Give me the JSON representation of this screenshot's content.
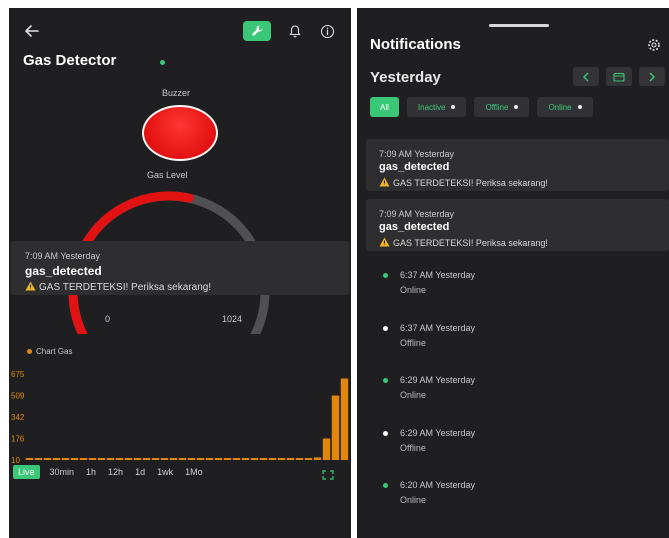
{
  "colors": {
    "accent": "#3ac878",
    "danger": "#e31212",
    "chart_orange": "#e3870c",
    "warning": "#f2b61d",
    "panel_bg": "#1f1f21",
    "card_bg": "#2e2e31"
  },
  "left": {
    "header": {
      "back_icon": "arrow-left-icon",
      "wrench_icon": "wrench-icon",
      "bell_icon": "bell-icon",
      "info_icon": "info-icon"
    },
    "device_title": "Gas Detector",
    "buzzer_label": "Buzzer",
    "gas_level_label": "Gas Level",
    "gauge": {
      "min_label": "0",
      "max_label": "1024",
      "value_fraction": 0.55
    },
    "toast": {
      "time": "7:09 AM Yesterday",
      "title": "gas_detected",
      "message": "GAS TERDETEKSI! Periksa sekarang!"
    },
    "time_ranges": [
      "Live",
      "30min",
      "1h",
      "12h",
      "1d",
      "1wk",
      "1Mo"
    ],
    "expand_icon": "expand-icon"
  },
  "chart_data": {
    "type": "bar",
    "legend": "Chart Gas",
    "yticks": [
      "675",
      "509",
      "342",
      "176",
      "10"
    ],
    "ylim": [
      10,
      675
    ],
    "values": [
      22,
      22,
      22,
      22,
      22,
      22,
      22,
      22,
      22,
      22,
      22,
      22,
      22,
      22,
      22,
      22,
      22,
      22,
      22,
      22,
      22,
      22,
      22,
      22,
      22,
      22,
      22,
      22,
      22,
      22,
      22,
      22,
      30,
      176,
      509,
      640
    ]
  },
  "right": {
    "title": "Notifications",
    "settings_icon": "gear-icon",
    "day": "Yesterday",
    "filters": [
      {
        "label": "All",
        "active": true,
        "dot": false
      },
      {
        "label": "Inactive",
        "active": false,
        "dot": true
      },
      {
        "label": "Offline",
        "active": false,
        "dot": true
      },
      {
        "label": "Online",
        "active": false,
        "dot": true
      }
    ],
    "cards": [
      {
        "time": "7:09 AM Yesterday",
        "title": "gas_detected",
        "message": "GAS TERDETEKSI! Periksa sekarang!"
      },
      {
        "time": "7:09 AM Yesterday",
        "title": "gas_detected",
        "message": "GAS TERDETEKSI! Periksa sekarang!"
      }
    ],
    "events": [
      {
        "time": "6:37 AM Yesterday",
        "status": "Online"
      },
      {
        "time": "6:37 AM Yesterday",
        "status": "Offline"
      },
      {
        "time": "6:29 AM Yesterday",
        "status": "Online"
      },
      {
        "time": "6:29 AM Yesterday",
        "status": "Offline"
      },
      {
        "time": "6:20 AM Yesterday",
        "status": "Online"
      }
    ]
  }
}
